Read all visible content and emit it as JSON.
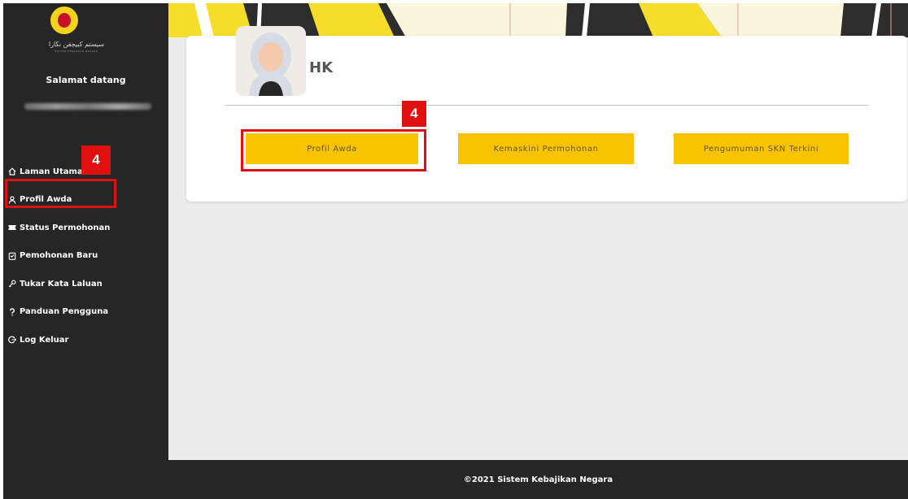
{
  "sidebar": {
    "logo_text": "سيستم كبيجقن نڬارا",
    "logo_subtitle": "SISTEM KEBAJIKAN NEGARA",
    "welcome": "Salamat datang",
    "items": [
      {
        "label": "Laman Utama",
        "icon": "home-icon"
      },
      {
        "label": "Profil Awda",
        "icon": "user-icon"
      },
      {
        "label": "Status Permohonan",
        "icon": "ticket-icon"
      },
      {
        "label": "Pemohonan Baru",
        "icon": "clipboard-icon"
      },
      {
        "label": "Tukar Kata Laluan",
        "icon": "key-icon"
      },
      {
        "label": "Panduan Pengguna",
        "icon": "help-icon"
      },
      {
        "label": "Log Keluar",
        "icon": "logout-icon"
      }
    ]
  },
  "profile": {
    "name": "HK",
    "avatar_icon": "avatar-hijab-icon"
  },
  "buttons": {
    "profil": "Profil Awda",
    "kemaskini": "Kemaskini Permohonan",
    "pengumuman": "Pengumuman SKN Terkini"
  },
  "annotations": {
    "step_sidebar": "4",
    "step_button": "4",
    "color": "#e01010"
  },
  "footer": {
    "text": "©2021 Sistem Kebajikan Negara"
  },
  "colors": {
    "sidebar_bg": "#262626",
    "accent_yellow": "#f8c300",
    "footer_bg": "#262626"
  }
}
